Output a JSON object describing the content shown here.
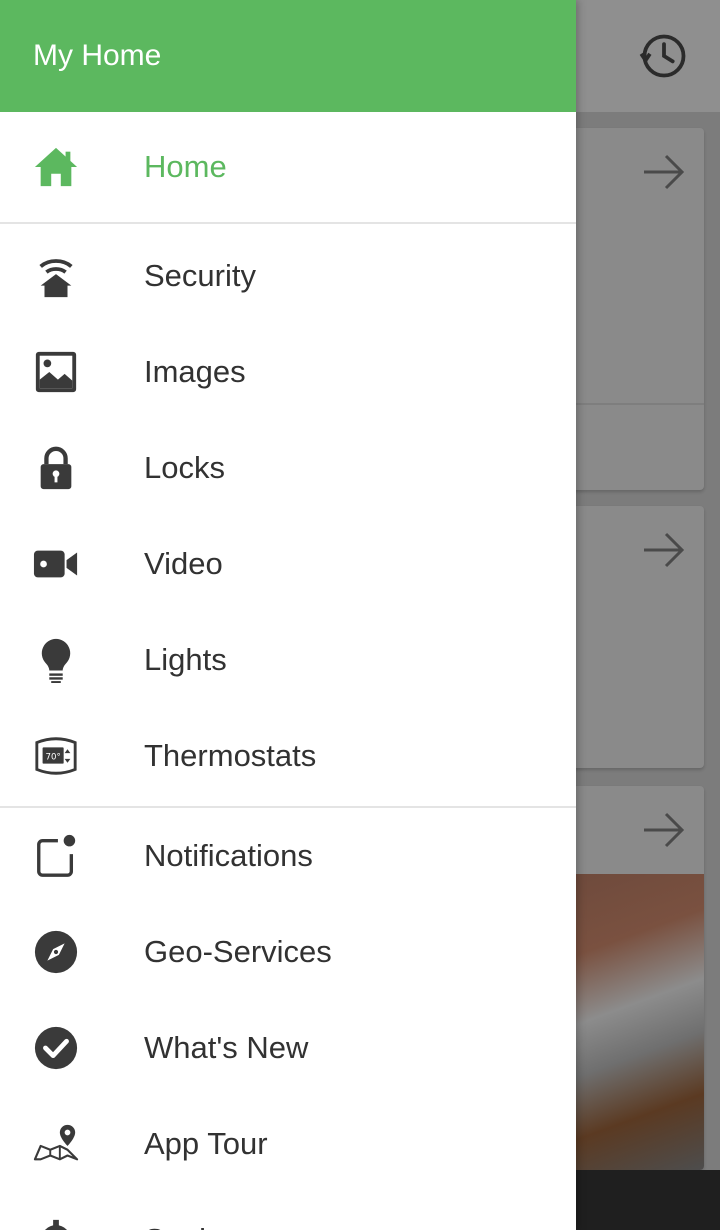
{
  "drawer": {
    "title": "My Home",
    "primary": [
      {
        "id": "home",
        "label": "Home",
        "icon": "home-icon",
        "active": true
      }
    ],
    "devices": [
      {
        "id": "security",
        "label": "Security",
        "icon": "security-house-icon"
      },
      {
        "id": "images",
        "label": "Images",
        "icon": "image-icon"
      },
      {
        "id": "locks",
        "label": "Locks",
        "icon": "lock-icon"
      },
      {
        "id": "video",
        "label": "Video",
        "icon": "video-camera-icon"
      },
      {
        "id": "lights",
        "label": "Lights",
        "icon": "light-bulb-icon"
      },
      {
        "id": "thermostats",
        "label": "Thermostats",
        "icon": "thermostat-icon"
      }
    ],
    "more": [
      {
        "id": "notifications",
        "label": "Notifications",
        "icon": "notification-icon"
      },
      {
        "id": "geo-services",
        "label": "Geo-Services",
        "icon": "compass-icon"
      },
      {
        "id": "whats-new",
        "label": "What's New",
        "icon": "check-circle-icon"
      },
      {
        "id": "app-tour",
        "label": "App Tour",
        "icon": "map-pin-icon"
      },
      {
        "id": "settings",
        "label": "Settings",
        "icon": "gear-icon"
      }
    ],
    "thermostat_badge": "70°"
  },
  "background": {
    "history_icon": "history-icon",
    "arrow_icon": "arrow-right-icon"
  },
  "colors": {
    "accent": "#5cb85f",
    "text": "#323232",
    "icon": "#3a3a3a",
    "scrim": "#7c7c7c"
  }
}
